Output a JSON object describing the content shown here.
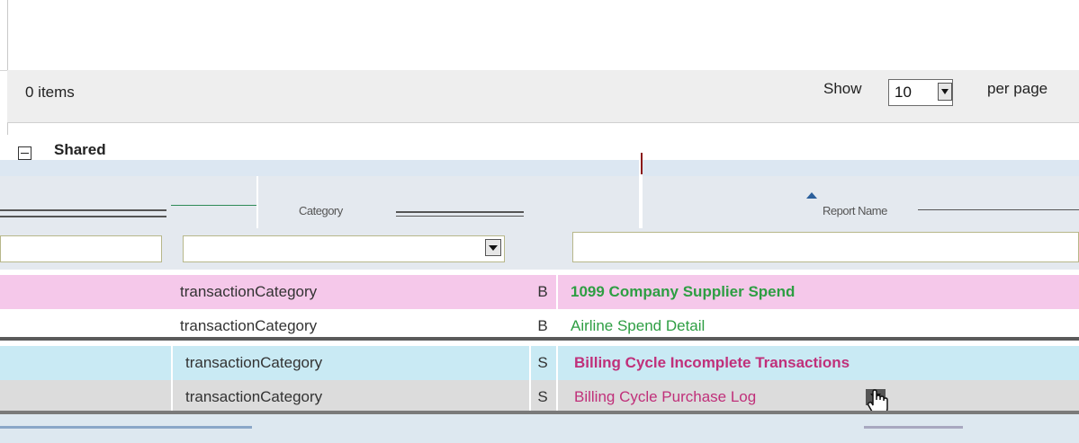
{
  "toolbar": {
    "items_count": "0 items",
    "show_label": "Show",
    "per_page_value": "10",
    "per_page_label": "per page"
  },
  "group": {
    "label": "Shared"
  },
  "columns": {
    "col2_header": "Category",
    "col4_header": "Report Name"
  },
  "rows": [
    {
      "category": "transactionCategory",
      "type": "B",
      "name": "1099 Company Supplier Spend",
      "color": "#2e9e43"
    },
    {
      "category": "transactionCategory",
      "type": "B",
      "name": "Airline Spend Detail",
      "color": "#2e9e43"
    },
    {
      "category": "transactionCategory",
      "type": "S",
      "name": "Billing Cycle Incomplete Transactions",
      "color": "#c0307a"
    },
    {
      "category": "transactionCategory",
      "type": "S",
      "name": "Billing Cycle Purchase Log",
      "color": "#c0307a"
    }
  ],
  "colors": {
    "pink_row": "#f5c8ea",
    "cyan_row": "#c9eaf4",
    "grey_row": "#dcdcdc",
    "header_bg": "#e4e9ef"
  },
  "icons": {
    "per_page_dropdown": "chevron-down-icon",
    "collapse": "minus-square-icon",
    "sort": "sort-asc-icon",
    "cursor": "hand-pointer-icon"
  }
}
